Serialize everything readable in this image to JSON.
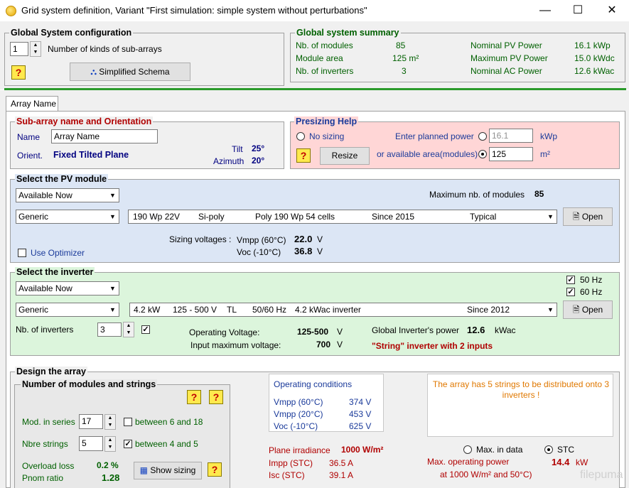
{
  "window": {
    "title": "Grid system definition, Variant  \"First simulation: simple system without perturbations\"",
    "minimize": "—",
    "maximize": "☐",
    "close": "✕"
  },
  "global_config": {
    "title": "Global System configuration",
    "kinds_value": "1",
    "kinds_label": "Number of kinds of sub-arrays",
    "schema_button": "Simplified Schema"
  },
  "summary": {
    "title": "Global system summary",
    "nb_modules_label": "Nb. of modules",
    "nb_modules_value": "85",
    "module_area_label": "Module area",
    "module_area_value": "125 m²",
    "nb_inverters_label": "Nb. of inverters",
    "nb_inverters_value": "3",
    "nominal_pv_label": "Nominal PV Power",
    "nominal_pv_value": "16.1  kWp",
    "max_pv_label": "Maximum PV Power",
    "max_pv_value": "15.0  kWdc",
    "nominal_ac_label": "Nominal AC Power",
    "nominal_ac_value": "12.6  kWac"
  },
  "tab": {
    "label": "Array Name"
  },
  "orientation": {
    "title": "Sub-array name and Orientation",
    "name_label": "Name",
    "name_value": "Array Name",
    "orient_label": "Orient.",
    "orient_value": "Fixed Tilted Plane",
    "tilt_label": "Tilt",
    "tilt_value": "25°",
    "azimuth_label": "Azimuth",
    "azimuth_value": "20°"
  },
  "presizing": {
    "title": "Presizing Help",
    "no_sizing": "No sizing",
    "enter_power_label": "Enter planned power",
    "power_value": "16.1",
    "power_unit": "kWp",
    "resize_button": "Resize",
    "area_label": "or available area(modules)",
    "area_value": "125",
    "area_unit": "m²"
  },
  "pv_module": {
    "title": "Select the PV module",
    "filter": "Available Now",
    "max_modules_label": "Maximum nb. of modules",
    "max_modules_value": "85",
    "manufacturer": "Generic",
    "model": {
      "power": "190 Wp 22V",
      "tech": "Si-poly",
      "name": "Poly 190 Wp  54 cells",
      "since": "Since 2015",
      "type": "Typical"
    },
    "open_button": "Open",
    "sizing_label": "Sizing voltages :",
    "vmpp_label": "Vmpp (60°C)",
    "vmpp_value": "22.0",
    "voc_label": "Voc  (-10°C)",
    "voc_value": "36.8",
    "volt_unit": "V",
    "optimizer_label": "Use Optimizer"
  },
  "inverter": {
    "title": "Select the inverter",
    "filter": "Available Now",
    "hz50": "50 Hz",
    "hz60": "60 Hz",
    "manufacturer": "Generic",
    "model": {
      "power": "4.2 kW",
      "range": "125 - 500 V",
      "type": "TL",
      "freq": "50/60 Hz",
      "name": "4.2 kWac inverter",
      "since": "Since 2012"
    },
    "open_button": "Open",
    "nb_label": "Nb. of inverters",
    "nb_value": "3",
    "op_voltage_label": "Operating Voltage:",
    "op_voltage_value": "125-500",
    "input_max_label": "Input maximum voltage:",
    "input_max_value": "700",
    "volt_unit": "V",
    "global_power_label": "Global Inverter's power",
    "global_power_value": "12.6",
    "global_power_unit": "kWac",
    "string_note": "\"String\" inverter with 2 inputs"
  },
  "design": {
    "title": "Design the array",
    "modules_title": "Number of modules and strings",
    "series_label": "Mod. in series",
    "series_value": "17",
    "series_between": "between 6 and 18",
    "strings_label": "Nbre strings",
    "strings_value": "5",
    "strings_between": "between 4 and 5",
    "overload_label": "Overload loss",
    "overload_value": "0.2 %",
    "pnom_label": "Pnom ratio",
    "pnom_value": "1.28",
    "show_sizing": "Show sizing",
    "op_cond_title": "Operating conditions",
    "vmpp60_label": "Vmpp (60°C)",
    "vmpp60_value": "374  V",
    "vmpp20_label": "Vmpp (20°C)",
    "vmpp20_value": "453  V",
    "voc10_label": "Voc  (-10°C)",
    "voc10_value": "625  V",
    "plane_label": "Plane irradiance",
    "plane_value": "1000 W/m²",
    "impp_label": "Impp (STC)",
    "impp_value": "36.5 A",
    "isc_label": "Isc  (STC)",
    "isc_value": "39.1 A",
    "message": "The array has 5 strings to be distributed onto 3 inverters !",
    "max_in_data": "Max. in data",
    "stc": "STC",
    "max_op_label": "Max. operating power",
    "max_op_sub": "at 1000 W/m² and 50°C)",
    "max_op_value": "14.4",
    "max_op_unit": "kW"
  },
  "watermark": "filepuma"
}
